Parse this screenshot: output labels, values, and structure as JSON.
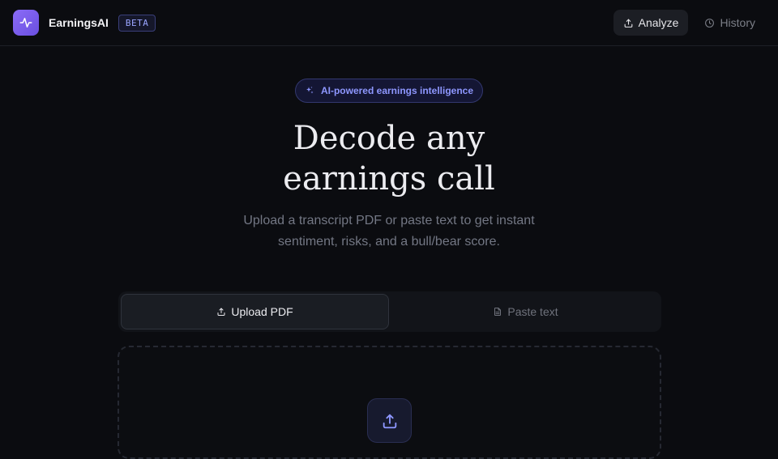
{
  "header": {
    "brand": "EarningsAI",
    "badge": "BETA",
    "logo_icon": "pulse-icon",
    "nav": [
      {
        "label": "Analyze",
        "icon": "upload-icon",
        "active": true
      },
      {
        "label": "History",
        "icon": "clock-icon",
        "active": false
      }
    ]
  },
  "hero": {
    "pill_text": "AI-powered earnings intelligence",
    "pill_icon": "sparkle-icon",
    "title_line1": "Decode any",
    "title_line2": "earnings call",
    "subtitle_line1": "Upload a transcript PDF or paste text to get instant",
    "subtitle_line2": "sentiment, risks, and a bull/bear score."
  },
  "input_tabs": [
    {
      "label": "Upload PDF",
      "icon": "upload-icon",
      "active": true
    },
    {
      "label": "Paste text",
      "icon": "document-icon",
      "active": false
    }
  ],
  "dropzone": {
    "icon": "upload-icon"
  },
  "colors": {
    "background": "#0b0c10",
    "accent": "#8b6cf7",
    "accent_text": "#8e97ff"
  }
}
